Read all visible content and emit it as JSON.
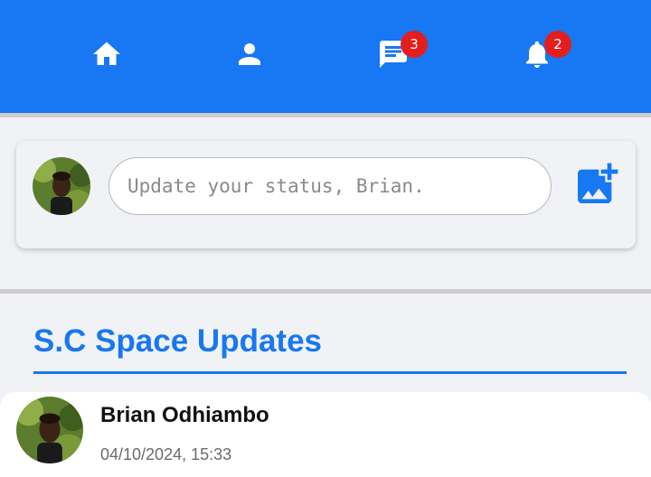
{
  "nav": {
    "home_icon": "home-icon",
    "profile_icon": "person-icon",
    "messages_icon": "chat-icon",
    "messages_badge": "3",
    "notifications_icon": "bell-icon",
    "notifications_badge": "2",
    "bar_color": "#1877f2",
    "badge_color": "#e41e1e"
  },
  "composer": {
    "placeholder": "Update your status, Brian.",
    "add_photo_icon": "add-photo-icon"
  },
  "feed": {
    "section_title": "S.C Space Updates",
    "posts": [
      {
        "author": "Brian Odhiambo",
        "timestamp": "04/10/2024, 15:33"
      }
    ]
  }
}
